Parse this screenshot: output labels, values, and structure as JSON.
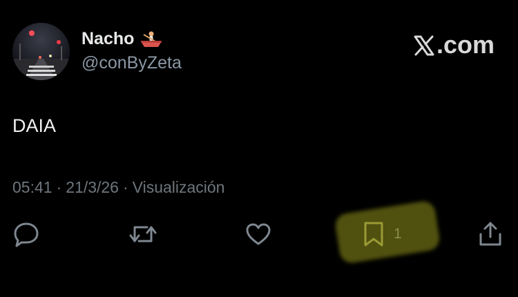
{
  "author": {
    "display_name": "Nacho",
    "name_emoji": "rowboat-icon",
    "handle": "@conByZeta"
  },
  "brand": {
    "logo": "x-logo-icon",
    "text": ".com"
  },
  "tweet": {
    "text": "DAIA",
    "time": "05:41",
    "separator": "·",
    "date": "21/3/26",
    "views_label": "Visualización"
  },
  "actions": {
    "reply_icon": "reply-icon",
    "retweet_icon": "retweet-icon",
    "like_icon": "heart-icon",
    "bookmark_icon": "bookmark-icon",
    "bookmark_count": "1",
    "share_icon": "share-icon"
  },
  "colors": {
    "background": "#000000",
    "text_primary": "#e7e9ea",
    "text_secondary": "#8b98a5",
    "icon": "#7f8790",
    "highlight": "#d2d228"
  }
}
